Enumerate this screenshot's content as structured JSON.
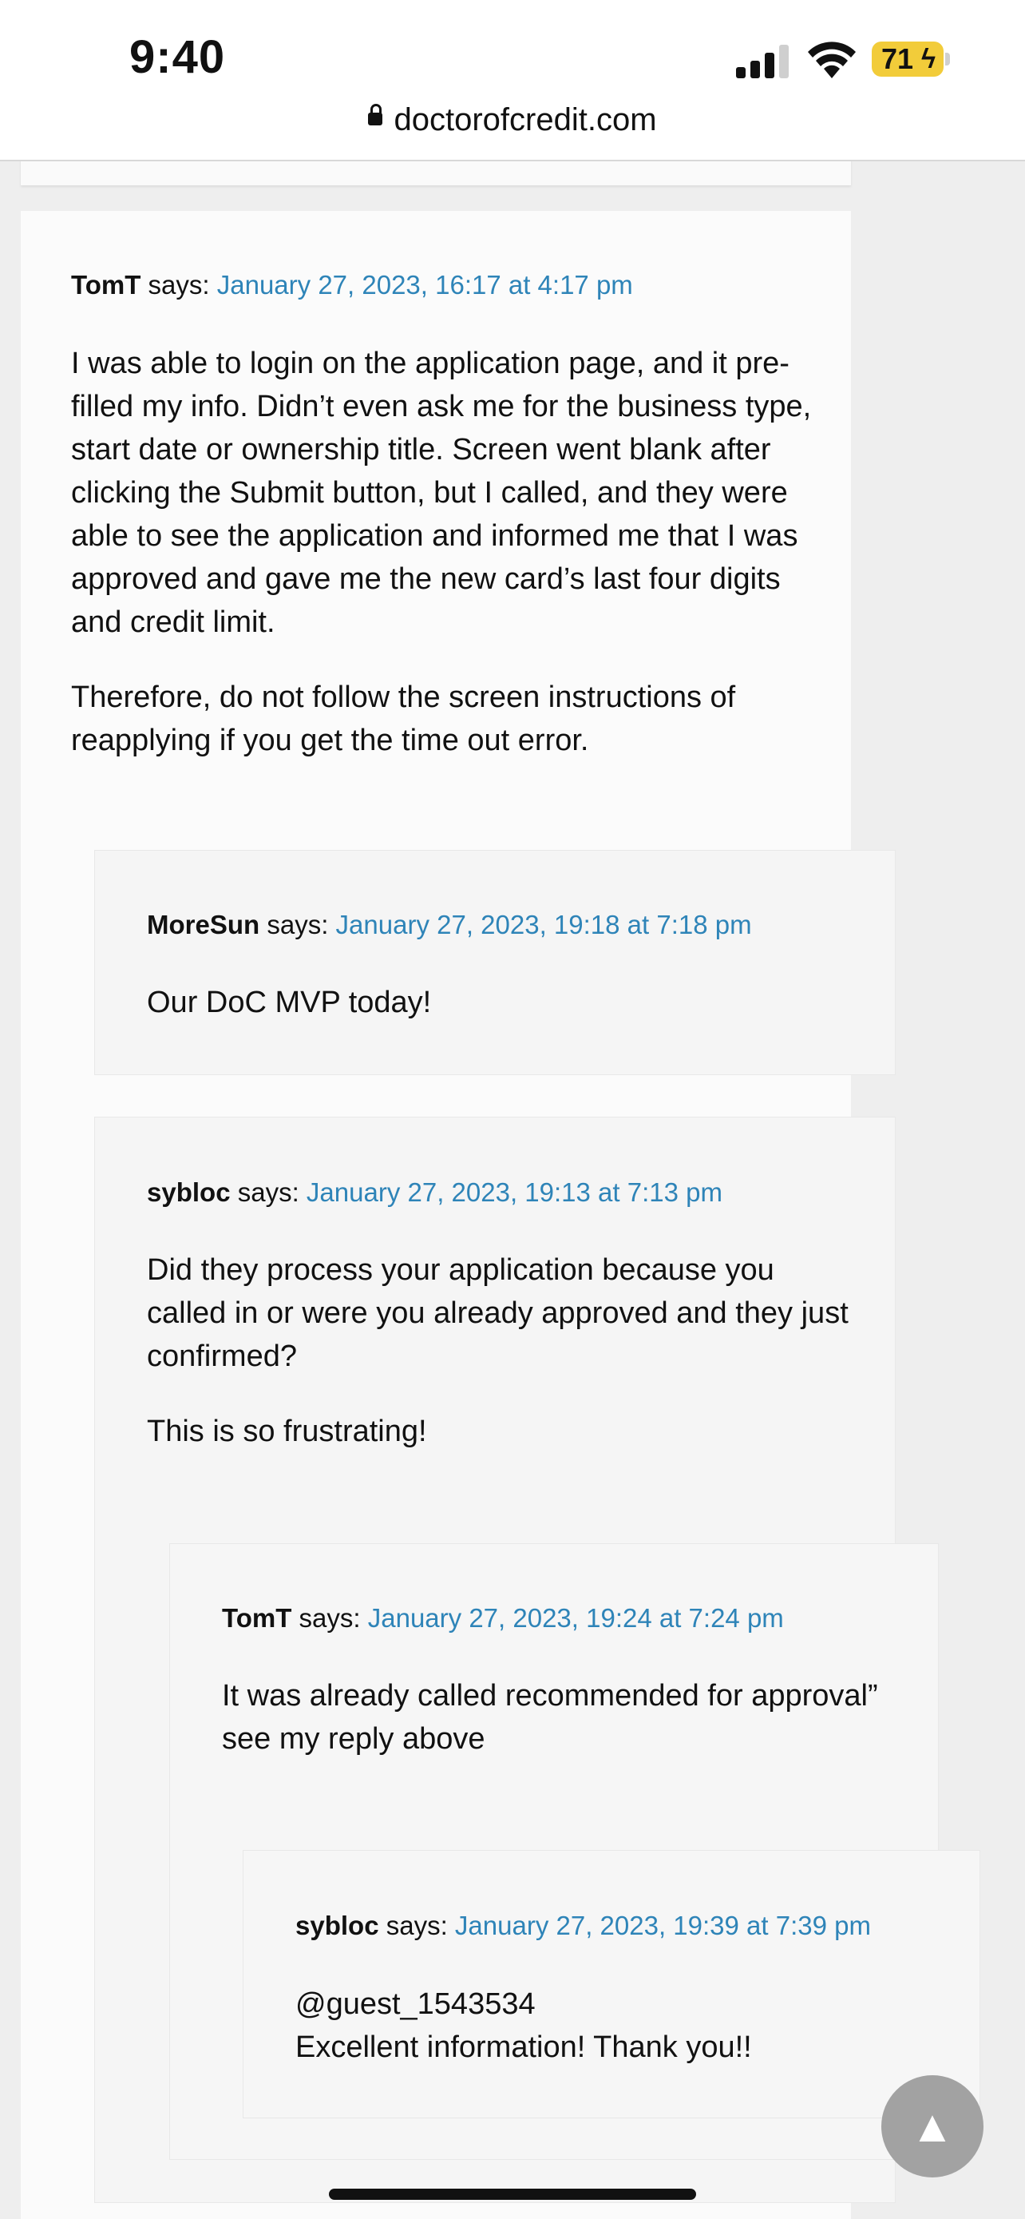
{
  "status_bar": {
    "time": "9:40",
    "battery": "71"
  },
  "browser": {
    "url": "doctorofcredit.com"
  },
  "comments": [
    {
      "author": "TomT",
      "says": "says:",
      "date": "January 27, 2023, 16:17 at 4:17 pm",
      "paragraphs": [
        "I was able to login on the application page, and it pre-filled my info. Didn’t even ask me for the business type, start date or ownership title. Screen went blank after clicking the Submit button, but I called, and they were able to see the application and informed me that I was approved and gave me the new card’s last four digits and credit limit.",
        "Therefore, do not follow the screen instructions of reapplying if you get the time out error."
      ]
    },
    {
      "author": "MoreSun",
      "says": "says:",
      "date": "January 27, 2023, 19:18 at 7:18 pm",
      "paragraphs": [
        "Our DoC MVP today!"
      ]
    },
    {
      "author": "sybloc",
      "says": "says:",
      "date": "January 27, 2023, 19:13 at 7:13 pm",
      "paragraphs": [
        "Did they process your application because you called in or were you already approved and they just confirmed?",
        "This is so frustrating!"
      ]
    },
    {
      "author": "TomT",
      "says": "says:",
      "date": "January 27, 2023, 19:24 at 7:24 pm",
      "paragraphs": [
        "It was already called recommended for approval” see my reply above"
      ]
    },
    {
      "author": "sybloc",
      "says": "says:",
      "date": "January 27, 2023, 19:39 at 7:39 pm",
      "paragraphs": [
        "@guest_1543534",
        "Excellent information! Thank you!!"
      ]
    }
  ],
  "scroll_top_icon": "▲",
  "colors": {
    "link": "#2e84b8",
    "battery": "#f2cc3a"
  }
}
